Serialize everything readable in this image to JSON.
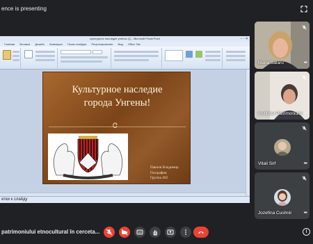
{
  "top": {
    "presenting_text": "ence is presenting"
  },
  "powerpoint": {
    "title": "культурное наследие унгены (1) - Microsoft PowerPoint",
    "tabs": [
      "Главная",
      "Вставка",
      "Дизайн",
      "Анимация",
      "Показ слайдов",
      "Рецензирование",
      "Вид",
      "Office Tab"
    ],
    "status_text": "етки к слайду"
  },
  "slide": {
    "title_line1": "Культурное наследие",
    "title_line2": "города Унгены!",
    "ornament": "Ꮳ",
    "caption_line1": "Павлов Владимир",
    "caption_line2": "География",
    "caption_line3": "Группа 402",
    "arms_motto": "VIRTUS ET UNITAS"
  },
  "participants": [
    {
      "name": "Maria Salaru",
      "mic": "off"
    },
    {
      "name": "Institutul Patrimoniului",
      "mic": "off"
    },
    {
      "name": "Vitali Sirf",
      "mic": "off"
    },
    {
      "name": "Jozefina Cushnir",
      "mic": "off"
    }
  ],
  "bottom": {
    "meeting_name": "patrimoniului etnocultural în cerceta..."
  },
  "colors": {
    "background": "#202124",
    "control_red": "#ea4335",
    "control_gray": "#3c4043",
    "slide_brown": "#8a5024"
  }
}
